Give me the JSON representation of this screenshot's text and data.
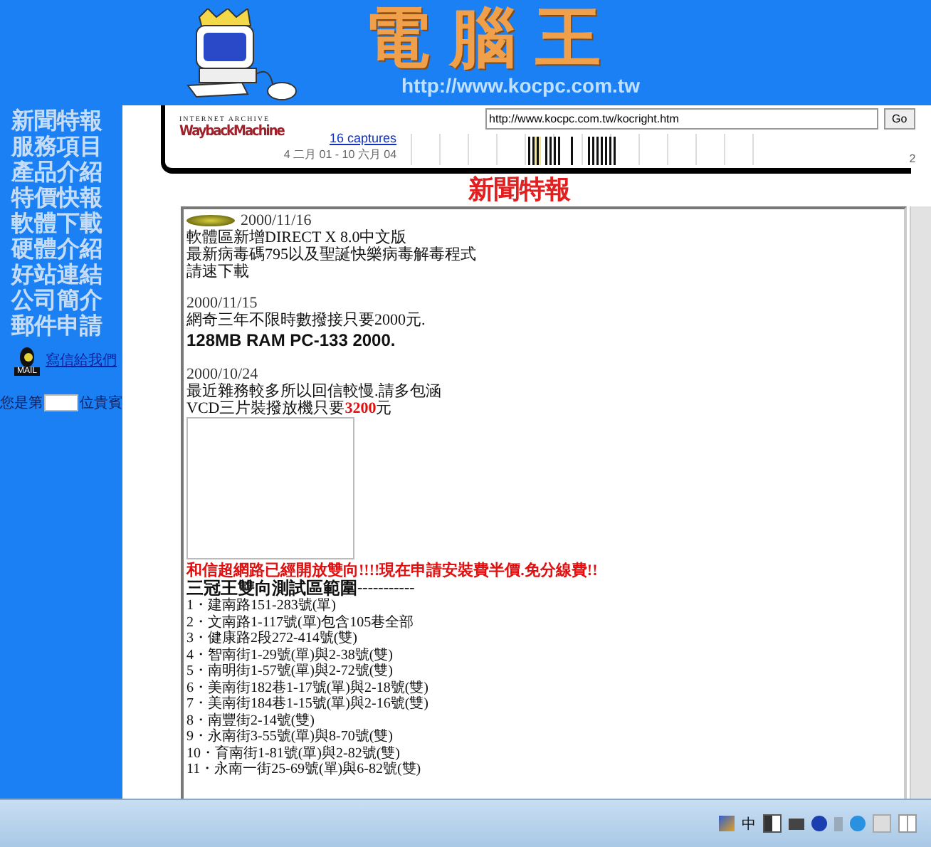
{
  "banner": {
    "title": "電腦王",
    "url": "http://www.kocpc.com.tw"
  },
  "sidebar": {
    "items": [
      {
        "label": "新聞特報"
      },
      {
        "label": "服務項目"
      },
      {
        "label": "產品介紹"
      },
      {
        "label": "特價快報"
      },
      {
        "label": "軟體下載"
      },
      {
        "label": "硬體介紹"
      },
      {
        "label": "好站連結"
      },
      {
        "label": "公司簡介"
      },
      {
        "label": "郵件申請"
      }
    ],
    "mail_badge": "MAIL",
    "mail_link": "寫信給我們",
    "counter_before": "您是第",
    "counter_after": "位貴賓"
  },
  "wayback": {
    "brand_top": "INTERNET ARCHIVE",
    "brand": "WaybackMachine",
    "url": "http://www.kocpc.com.tw/kocright.htm",
    "go": "Go",
    "captures": "16 captures",
    "range": "4 二月 01 - 10 六月 04",
    "edge": "2"
  },
  "page_title": "新聞特報",
  "news": [
    {
      "date": "2000/11/16",
      "lines": [
        "軟體區新增DIRECT X 8.0中文版",
        "最新病毒碼795以及聖誕快樂病毒解毒程式",
        "請速下載"
      ]
    },
    {
      "date": "2000/11/15",
      "lines": [
        "網奇三年不限時數撥接只要2000元."
      ],
      "highlight": "128MB RAM PC-133 2000."
    },
    {
      "date": "2000/10/24",
      "lines": [
        "最近雜務較多所以回信較慢.請多包涵",
        "VCD三片裝撥放機只要**3200**元"
      ]
    }
  ],
  "announcement": "和信超網路已經開放雙向!!!!現在申請安裝費半價.免分線費!!",
  "area_title": "三冠王雙向測試區範圍",
  "area_rule": "-----------",
  "areas": [
    "1・建南路151-283號(單)",
    "2・文南路1-117號(單)包含105巷全部",
    "3・健康路2段272-414號(雙)",
    "4・智南街1-29號(單)與2-38號(雙)",
    "5・南明街1-57號(單)與2-72號(雙)",
    "6・美南街182巷1-17號(單)與2-18號(雙)",
    "7・美南街184巷1-15號(單)與2-16號(雙)",
    "8・南豐街2-14號(雙)",
    "9・永南街3-55號(單)與8-70號(雙)",
    "10・育南街1-81號(單)與2-82號(雙)",
    "11・永南一街25-69號(單)與6-82號(雙)"
  ],
  "tray": {
    "ime": "中"
  }
}
